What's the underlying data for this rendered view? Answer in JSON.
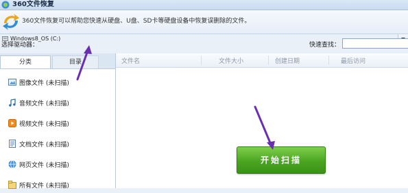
{
  "window": {
    "title": "360文件恢复"
  },
  "banner": {
    "description": "360文件恢复可以帮助您快速从硬盘、U盘、SD卡等硬盘设备中恢复误删除的文件。"
  },
  "drive": {
    "label": "选择驱动器：",
    "selected": "Windows8_OS (C:)"
  },
  "search": {
    "label": "快速查找：",
    "value": ""
  },
  "tabs": [
    {
      "label": "分类",
      "active": true
    },
    {
      "label": "目录",
      "active": false
    }
  ],
  "categories": [
    {
      "label": "图像文件 (未扫描)",
      "icon": "image-icon"
    },
    {
      "label": "音频文件 (未扫描)",
      "icon": "music-icon"
    },
    {
      "label": "视频文件 (未扫描)",
      "icon": "video-icon"
    },
    {
      "label": "文档文件 (未扫描)",
      "icon": "document-icon"
    },
    {
      "label": "网页文件 (未扫描)",
      "icon": "webpage-icon"
    },
    {
      "label": "所有文件 (未扫描)",
      "icon": "all-files-icon"
    }
  ],
  "columns": [
    "文件名",
    "文件大小",
    "创建日期",
    "最后访问"
  ],
  "scan_button": {
    "label": "开始扫描"
  },
  "colors": {
    "scan_button": "#4aa521",
    "annotation_arrow": "#6a2fb0",
    "titlebar": "#c9dbef"
  }
}
